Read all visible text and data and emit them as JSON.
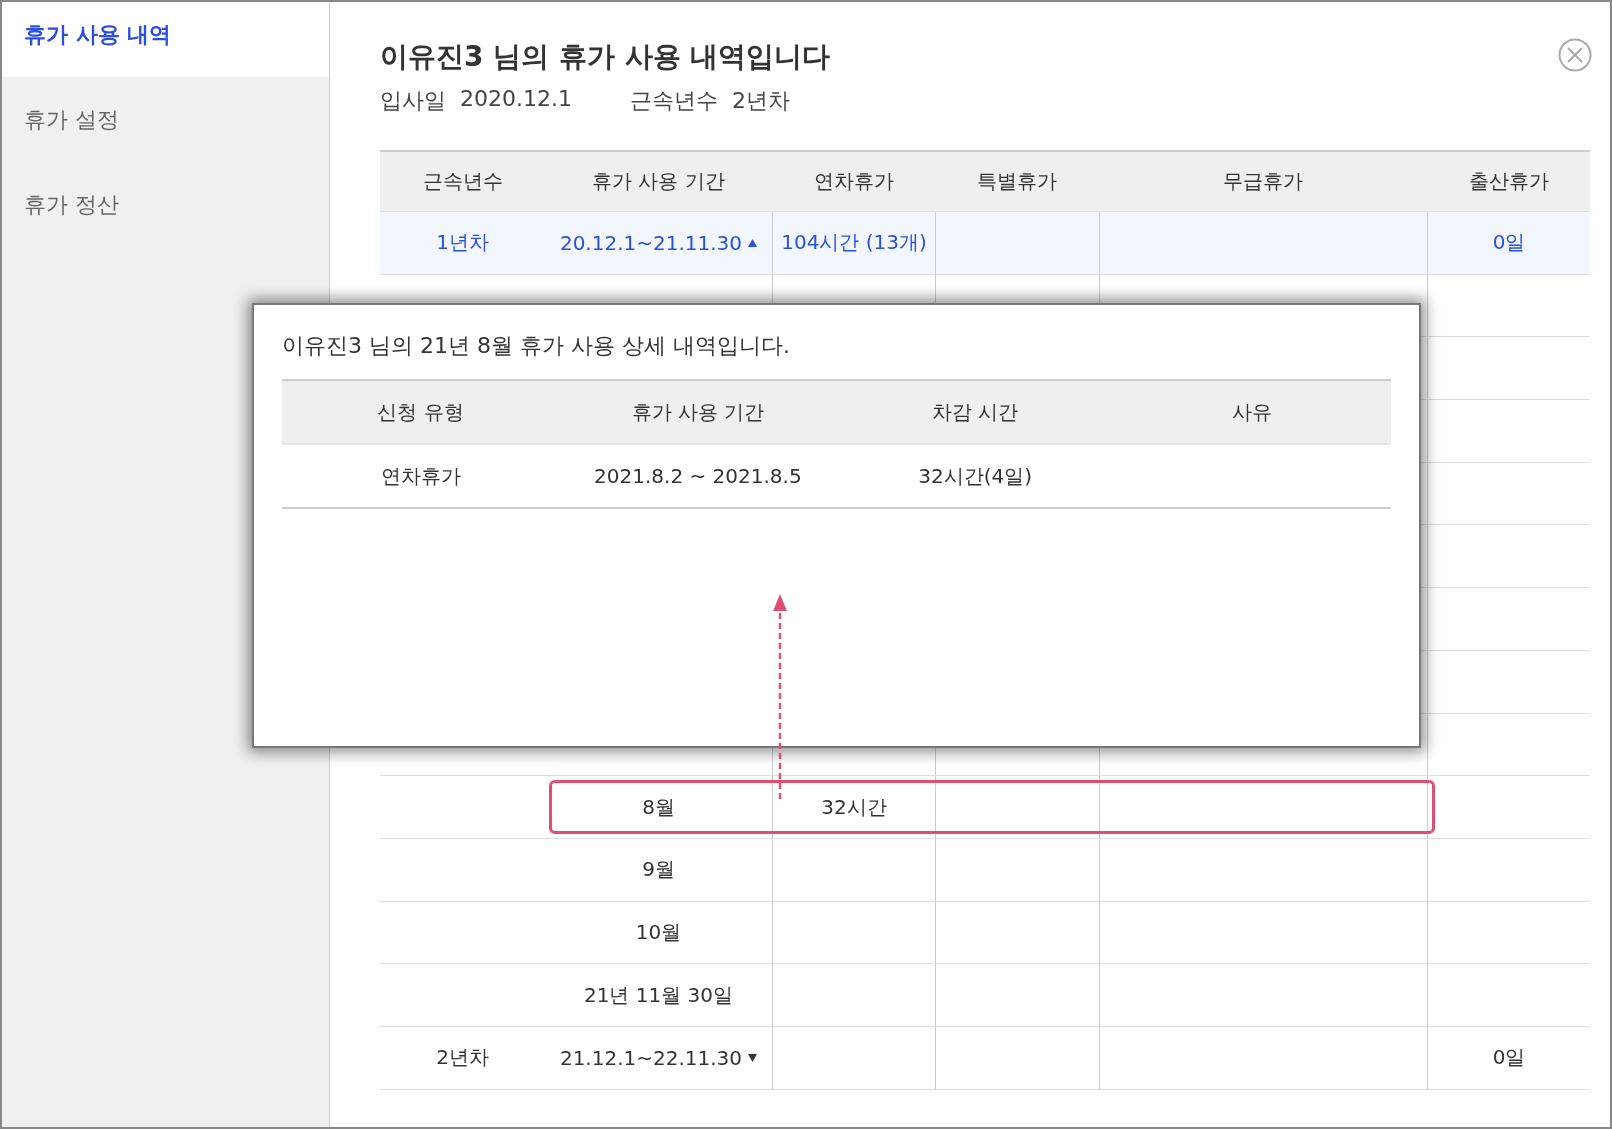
{
  "sidebar": {
    "items": [
      {
        "label": "휴가 사용 내역",
        "selected": true
      },
      {
        "label": "휴가 설정",
        "selected": false
      },
      {
        "label": "휴가 정산",
        "selected": false
      }
    ]
  },
  "header": {
    "title": "이유진3 님의 휴가 사용 내역입니다",
    "join_label": "입사일",
    "join_date": "2020.12.1",
    "tenure_label": "근속년수",
    "tenure": "2년차"
  },
  "table": {
    "columns": [
      "근속년수",
      "휴가 사용 기간",
      "연차휴가",
      "특별휴가",
      "무급휴가",
      "출산휴가"
    ],
    "rows": [
      {
        "kind": "year",
        "tenure": "1년차",
        "period": "20.12.1~21.11.30",
        "expanded": true,
        "selected": true,
        "annual": "104시간 (13개)",
        "maternity": "0일"
      },
      {
        "kind": "month"
      },
      {
        "kind": "month"
      },
      {
        "kind": "month"
      },
      {
        "kind": "month"
      },
      {
        "kind": "month"
      },
      {
        "kind": "month"
      },
      {
        "kind": "month"
      },
      {
        "kind": "month"
      },
      {
        "kind": "month",
        "period": "8월",
        "annual": "32시간",
        "highlighted": true
      },
      {
        "kind": "month",
        "period": "9월"
      },
      {
        "kind": "month",
        "period": "10월"
      },
      {
        "kind": "month",
        "period": "21년 11월 30일"
      },
      {
        "kind": "year",
        "tenure": "2년차",
        "period": "21.12.1~22.11.30",
        "expanded": false,
        "selected": false,
        "maternity": "0일"
      }
    ]
  },
  "popup": {
    "title": "이유진3 님의 21년 8월 휴가 사용 상세 내역입니다.",
    "columns": [
      "신청 유형",
      "휴가 사용 기간",
      "차감 시간",
      "사유"
    ],
    "rows": [
      [
        "연차휴가",
        "2021.8.2 ~ 2021.8.5",
        "32시간(4일)",
        ""
      ]
    ]
  }
}
